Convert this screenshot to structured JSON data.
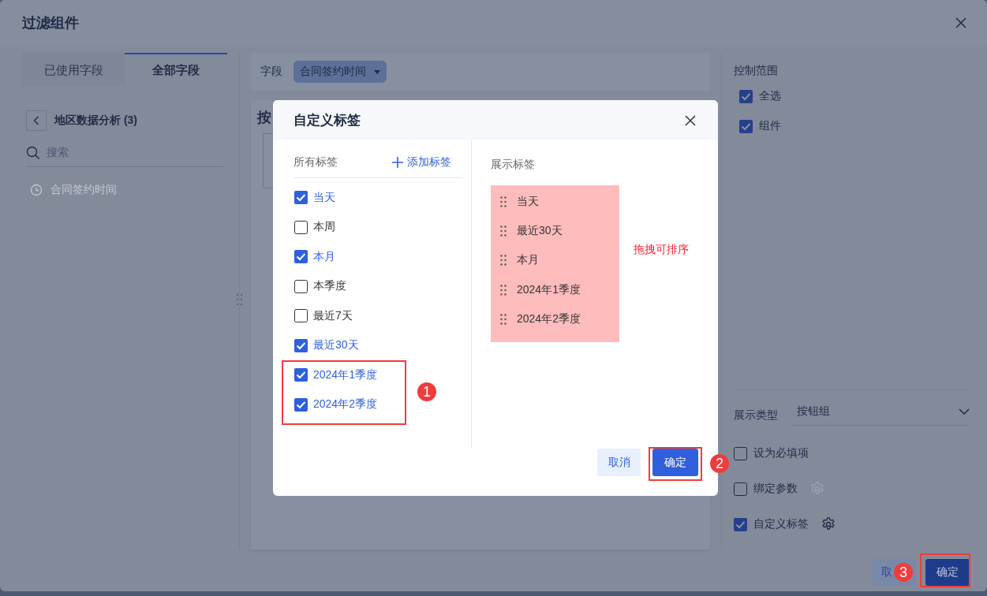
{
  "dialog": {
    "title": "过滤组件",
    "field_tabs": [
      {
        "label": "已使用字段",
        "selected": false
      },
      {
        "label": "全部字段",
        "selected": true
      }
    ],
    "dataset": {
      "name": "地区数据分析 (3)"
    },
    "search": {
      "placeholder": "搜索"
    },
    "fields": [
      {
        "label": "合同签约时间",
        "disabled": true
      }
    ],
    "field_bar": {
      "label": "字段",
      "value": "合同签约时间"
    },
    "panel_title": "按",
    "control_scope": {
      "title": "控制范围",
      "options": [
        {
          "label": "全选",
          "checked": true
        },
        {
          "label": "组件",
          "checked": true
        }
      ]
    },
    "display_type": {
      "label": "展示类型",
      "value": "按钮组"
    },
    "options": [
      {
        "label": "设为必填项",
        "checked": false,
        "settings": false
      },
      {
        "label": "绑定参数",
        "checked": false,
        "settings": true
      },
      {
        "label": "自定义标签",
        "checked": true,
        "settings": true
      }
    ],
    "footer": {
      "cancel": "取",
      "confirm": "确定"
    }
  },
  "modal": {
    "title": "自定义标签",
    "all_tags_label": "所有标签",
    "add_tag": "添加标签",
    "tags": [
      {
        "label": "当天",
        "checked": true
      },
      {
        "label": "本周",
        "checked": false
      },
      {
        "label": "本月",
        "checked": true
      },
      {
        "label": "本季度",
        "checked": false
      },
      {
        "label": "最近7天",
        "checked": false
      },
      {
        "label": "最近30天",
        "checked": true
      },
      {
        "label": "2024年1季度",
        "checked": true
      },
      {
        "label": "2024年2季度",
        "checked": true
      }
    ],
    "shown_label": "展示标签",
    "shown_tags": [
      "当天",
      "最近30天",
      "本月",
      "2024年1季度",
      "2024年2季度"
    ],
    "hint": "拖拽可排序",
    "cancel": "取消",
    "confirm": "确定"
  },
  "annotations": [
    {
      "number": "1"
    },
    {
      "number": "2"
    },
    {
      "number": "3"
    }
  ]
}
